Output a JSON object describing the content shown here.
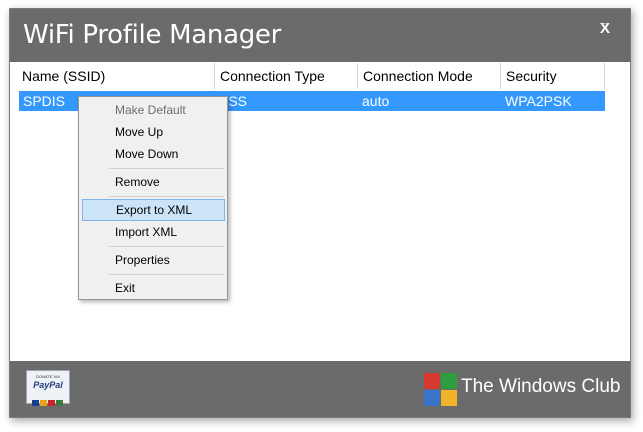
{
  "window": {
    "title": "WiFi Profile Manager",
    "minimize_glyph": "_",
    "close_glyph": "X"
  },
  "list": {
    "columns": [
      "Name (SSID)",
      "Connection Type",
      "Connection Mode",
      "Security"
    ],
    "rows": [
      [
        "SPDIS",
        "ESS",
        "auto",
        "WPA2PSK"
      ]
    ]
  },
  "context_menu": {
    "items": [
      {
        "label": "Make Default",
        "state": "disabled"
      },
      {
        "label": "Move Up",
        "state": "normal"
      },
      {
        "label": "Move Down",
        "state": "normal"
      },
      {
        "label": "Remove",
        "state": "normal"
      },
      {
        "label": "Export to XML",
        "state": "highlighted"
      },
      {
        "label": "Import XML",
        "state": "normal"
      },
      {
        "label": "Properties",
        "state": "normal"
      },
      {
        "label": "Exit",
        "state": "normal"
      }
    ]
  },
  "footer": {
    "paypal": {
      "top_text": "DONATE VIA",
      "brand": "PayPal"
    },
    "brand_text": "The Windows Club"
  },
  "colors": {
    "titlebar": "#6b6b6b",
    "selection": "#3399ff",
    "menu_highlight": "#cce4f7",
    "logo": [
      "#d6382f",
      "#2e9d3f",
      "#3a73c8",
      "#f1b32a"
    ]
  },
  "icons": [
    "paypal-badge-icon",
    "windows-club-logo-icon"
  ]
}
